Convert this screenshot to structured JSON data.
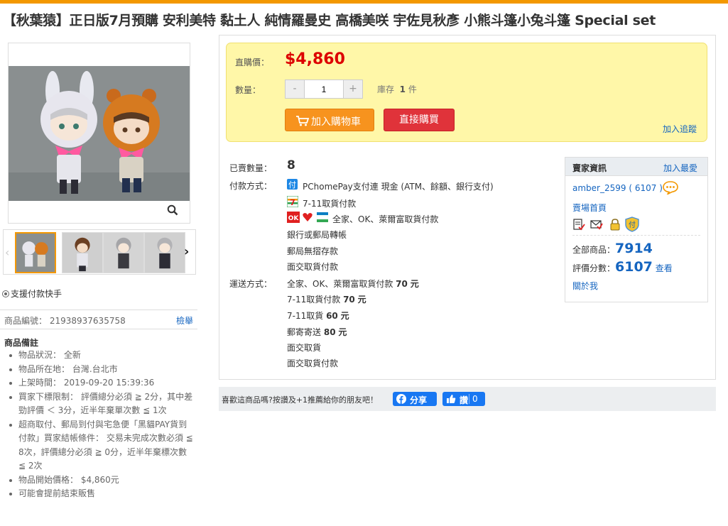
{
  "page": {
    "title": "【秋葉猿】正日版7月預購 安利美特 黏土人 純情羅曼史 高橋美咲 宇佐見秋彥 小熊斗篷小兔斗篷 Special set",
    "accent_color": "#f39800"
  },
  "gallery": {
    "thumbnail_count": 4
  },
  "left": {
    "quick_pay": "支援付款快手",
    "code_label": "商品編號：",
    "code_value": "21938937635758",
    "report_link": "檢舉",
    "notes_title": "商品備註",
    "notes": [
      "物品狀況： 全新",
      "物品所在地： 台灣.台北市",
      "上架時間： 2019-09-20 15:39:36",
      "買家下標限制： 評價總分必須 ≧ 2分，其中差勁評價 ＜ 3分，近半年棄單次數 ≦ 1次",
      "超商取付、郵局到付與宅急便「黑貓PAY貨到付款」買家結帳條件： 交易未完成次數必須 ≦ 8次，評價總分必須 ≧ 0分，近半年棄標次數 ≦ 2次",
      "物品開始價格： $4,860元",
      "可能會提前結束販售"
    ]
  },
  "buy_box": {
    "price_label": "直購價：",
    "price": "$4,860",
    "qty_label": "數量：",
    "qty_value": "1",
    "minus": "-",
    "plus": "+",
    "stock_label": "庫存",
    "stock_value": "1",
    "stock_unit": "件",
    "add_to_cart": "加入購物車",
    "buy_now": "直接購買",
    "track": "加入追蹤"
  },
  "info": {
    "sold_label": "已賣數量：",
    "sold_value": "8",
    "payment_label": "付款方式：",
    "payment_options": {
      "pchome": "PChomePay支付連 現金 (ATM、餘額、銀行支付)",
      "seven_cod": "7-11取貨付款",
      "family_ok_hilife": "全家、OK、萊爾富取貨付款",
      "bank": "銀行或郵局轉帳",
      "post": "郵局無摺存款",
      "face": "面交取貨付款"
    },
    "shipping_label": "運送方式：",
    "shipping_options": [
      {
        "name": "全家、OK、萊爾富取貨付款",
        "price": "70",
        "unit": "元"
      },
      {
        "name": "7-11取貨付款",
        "price": "70",
        "unit": "元"
      },
      {
        "name": "7-11取貨",
        "price": "60",
        "unit": "元"
      },
      {
        "name": "郵寄寄送",
        "price": "80",
        "unit": "元"
      },
      {
        "name": "面交取貨",
        "price": "",
        "unit": ""
      },
      {
        "name": "面交取貨付款",
        "price": "",
        "unit": ""
      }
    ]
  },
  "seller": {
    "header": "賣家資訊",
    "favorite": "加入最愛",
    "name": "amber_2599",
    "rating_paren": "( 6107 )",
    "store_link": "賣場首頁",
    "all_items_label": "全部商品：",
    "all_items_value": "7914",
    "score_label": "評價分數：",
    "score_value": "6107",
    "score_link": "查看",
    "about": "關於我"
  },
  "share": {
    "text": "喜歡這商品嗎?按讚及+1推薦給你的朋友吧！",
    "fb_share": "分享",
    "fb_like": "讚",
    "fb_like_count": "0"
  }
}
